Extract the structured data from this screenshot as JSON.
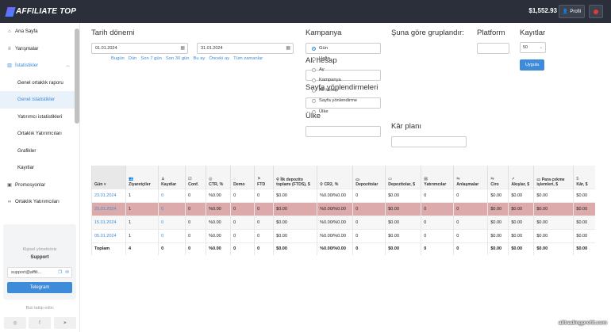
{
  "brand": {
    "name": "AFFILIATE TOP"
  },
  "header": {
    "balance": "$1,552.93",
    "profile_label": "Profil"
  },
  "sidebar": {
    "items": [
      {
        "label": "Ana Sayfa",
        "icon": "home-icon"
      },
      {
        "label": "Yarışmalar",
        "icon": "trophy-icon"
      },
      {
        "label": "İstatistikler",
        "icon": "chart-icon"
      },
      {
        "label": "Genel ortaklık raporu"
      },
      {
        "label": "Genel istatistikler"
      },
      {
        "label": "Yatırımcı istatistikleri"
      },
      {
        "label": "Ortaklık Yatırımcıları"
      },
      {
        "label": "Grafikler"
      },
      {
        "label": "Kayıtlar"
      },
      {
        "label": "Promosyonlar",
        "icon": "image-icon"
      },
      {
        "label": "Ortaklık Yatırımcıları",
        "icon": "link-icon"
      }
    ],
    "support": {
      "title": "Kişisel yöneticiniz",
      "name": "Support",
      "email": "support@affili...",
      "telegram_label": "Telegram"
    },
    "follow_label": "Bizi takip edin:"
  },
  "filters": {
    "date_label": "Tarih dönemi",
    "date_from": "01.01.2024",
    "date_to": "31.01.2024",
    "quick_ranges": [
      "Bugün",
      "Dün",
      "Son 7 gün",
      "Son 30 gün",
      "Bu ay",
      "Önceki ay",
      "Tüm zamanlar"
    ],
    "campaign_label": "Kampanya",
    "subaccount_label": "Alt hesap",
    "redirect_label": "Sayfa yönlendirmeleri",
    "country_label": "Ülke",
    "group_label": "Şuna göre gruplandır:",
    "group_options": [
      "Gün",
      "Hafta",
      "Ay",
      "Kampanya",
      "Alt hesap",
      "Sayfa yönlendirme",
      "Ülke"
    ],
    "group_selected": "Gün",
    "profit_plan_label": "Kâr planı",
    "platform_label": "Platform",
    "records_label": "Kayıtlar",
    "records_value": "50",
    "apply_label": "Uygula"
  },
  "table": {
    "columns": [
      "Gün",
      "Ziyaretçiler",
      "Kayıtlar",
      "Conf.",
      "CTR, %",
      "Demo",
      "FTD",
      "İlk depozito toplamı (FTDS), $",
      "CR2, %",
      "Depozitolar",
      "Depozitolar, $",
      "Yatırımcılar",
      "Anlaşmalar",
      "Ciro",
      "Akışlar, $",
      "Para çekme işlemleri, $",
      "Kâr, $"
    ],
    "rows": [
      [
        "23.01.2024",
        "1",
        "0",
        "0",
        "%0.00",
        "0",
        "0",
        "$0.00",
        "%0.00/%0.00",
        "0",
        "$0.00",
        "0",
        "0",
        "$0.00",
        "$0.00",
        "$0.00",
        "$0.00"
      ],
      [
        "20.01.2024",
        "1",
        "0",
        "0",
        "%0.00",
        "0",
        "0",
        "$0.00",
        "%0.00/%0.00",
        "0",
        "$0.00",
        "0",
        "0",
        "$0.00",
        "$0.00",
        "$0.00",
        "$0.00"
      ],
      [
        "15.01.2024",
        "1",
        "0",
        "0",
        "%0.00",
        "0",
        "0",
        "$0.00",
        "%0.00/%0.00",
        "0",
        "$0.00",
        "0",
        "0",
        "$0.00",
        "$0.00",
        "$0.00",
        "$0.00"
      ],
      [
        "05.01.2024",
        "1",
        "0",
        "0",
        "%0.00",
        "0",
        "0",
        "$0.00",
        "%0.00/%0.00",
        "0",
        "$0.00",
        "0",
        "0",
        "$0.00",
        "$0.00",
        "$0.00",
        "$0.00"
      ]
    ],
    "total": [
      "Toplam",
      "4",
      "0",
      "0",
      "%0.00",
      "0",
      "0",
      "$0.00",
      "%0.00/%0.00",
      "0",
      "$0.00",
      "0",
      "0",
      "$0.00",
      "$0.00",
      "$0.00",
      "$0.00"
    ]
  },
  "watermark": "alltradingprofit.com"
}
